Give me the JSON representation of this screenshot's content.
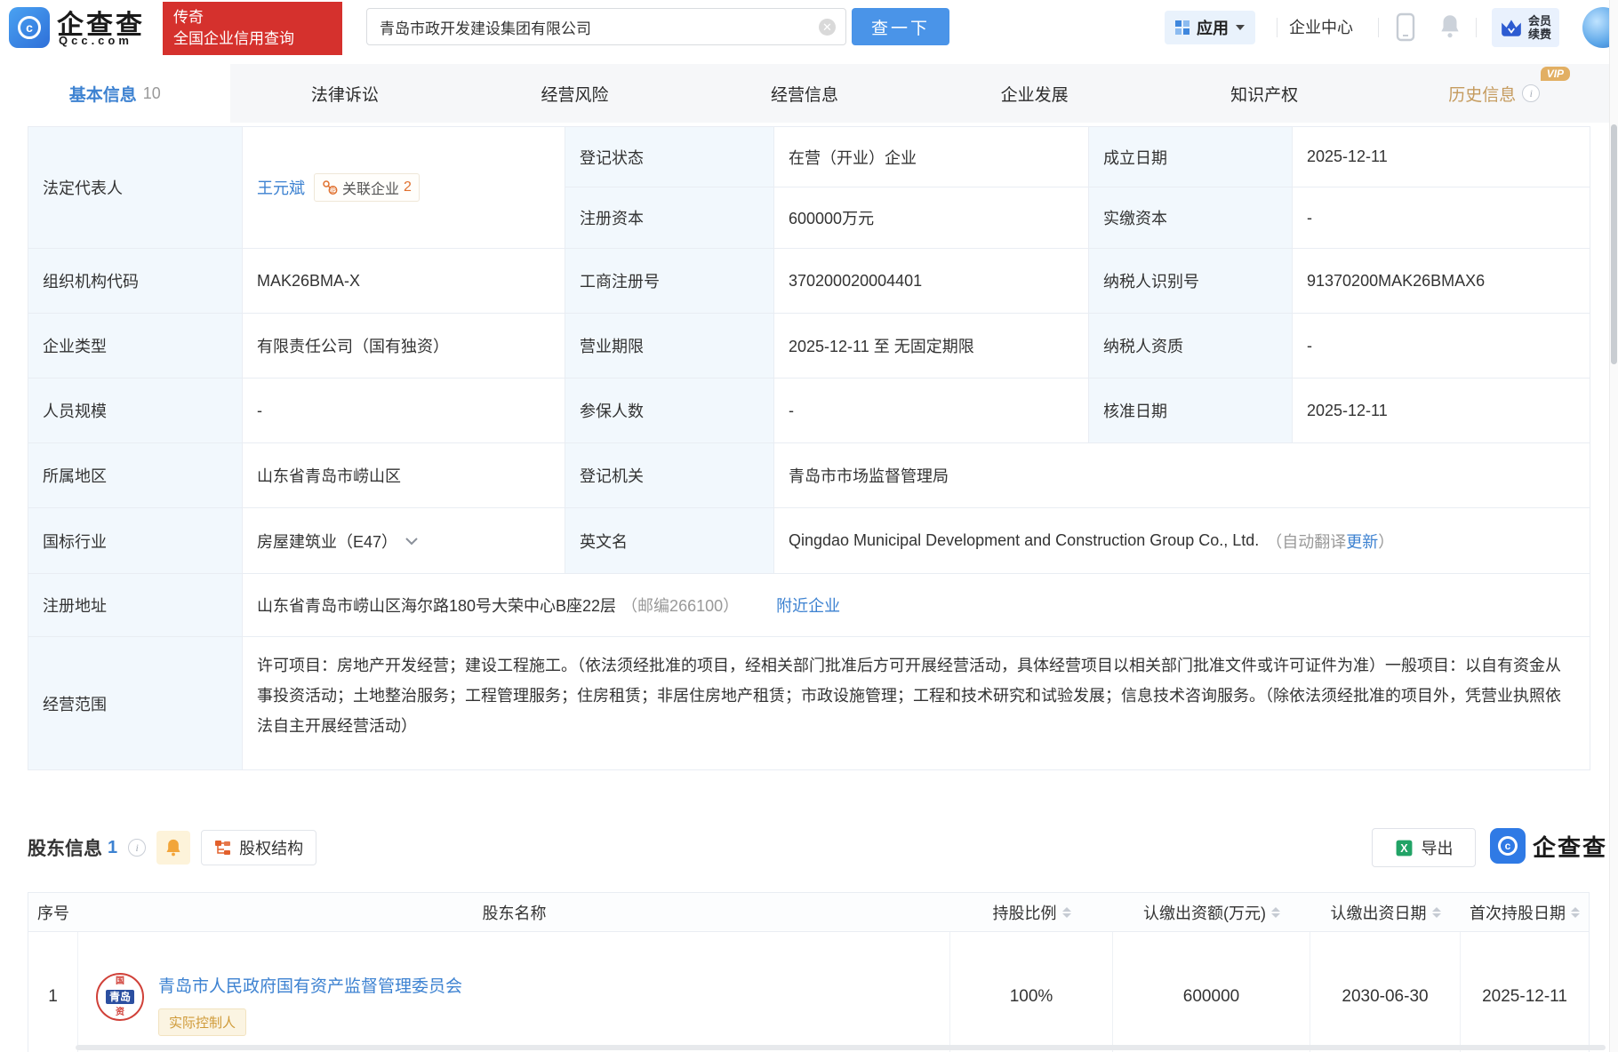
{
  "watermark": "企查查",
  "colors": {
    "brand_blue": "#3d82d1",
    "promo_red": "#d5312d",
    "history_gold": "#c59b5e",
    "accent_orange": "#e0702e",
    "excel_green": "#21a366"
  },
  "header": {
    "logo_title": "企查查",
    "logo_subtitle": "Qcc.com",
    "promo_line1": "传奇",
    "promo_line2": "全国企业信用查询",
    "search_value": "青岛市政开发建设集团有限公司",
    "search_button": "查一下",
    "apps_label": "应用",
    "enterprise_center": "企业中心",
    "vip_line1": "会员",
    "vip_line2": "续费"
  },
  "tabs": [
    {
      "label": "基本信息",
      "count": "10"
    },
    {
      "label": "法律诉讼"
    },
    {
      "label": "经营风险"
    },
    {
      "label": "经营信息"
    },
    {
      "label": "企业发展"
    },
    {
      "label": "知识产权"
    },
    {
      "label": "历史信息",
      "vip": "VIP"
    }
  ],
  "info": {
    "legal_rep_label": "法定代表人",
    "legal_rep": "王元斌",
    "related_label": "关联企业",
    "related_count": "2",
    "reg_status_label": "登记状态",
    "reg_status": "在营（开业）企业",
    "est_date_label": "成立日期",
    "est_date": "2025-12-11",
    "reg_capital_label": "注册资本",
    "reg_capital": "600000万元",
    "paid_capital_label": "实缴资本",
    "paid_capital": "-",
    "org_code_label": "组织机构代码",
    "org_code": "MAK26BMA-X",
    "biz_reg_no_label": "工商注册号",
    "biz_reg_no": "370200020004401",
    "tax_id_label": "纳税人识别号",
    "tax_id": "91370200MAK26BMAX6",
    "company_type_label": "企业类型",
    "company_type": "有限责任公司（国有独资）",
    "biz_term_label": "营业期限",
    "biz_term": "2025-12-11 至 无固定期限",
    "taxpayer_qual_label": "纳税人资质",
    "taxpayer_qual": "-",
    "staff_size_label": "人员规模",
    "staff_size": "-",
    "insured_label": "参保人数",
    "insured": "-",
    "approval_date_label": "核准日期",
    "approval_date": "2025-12-11",
    "region_label": "所属地区",
    "region": "山东省青岛市崂山区",
    "reg_authority_label": "登记机关",
    "reg_authority": "青岛市市场监督管理局",
    "industry_label": "国标行业",
    "industry": "房屋建筑业（E47）",
    "en_name_label": "英文名",
    "en_name": "Qingdao Municipal Development and Construction Group Co., Ltd.",
    "en_name_note_open": "（自动翻译",
    "en_name_update": "更新",
    "en_name_note_close": "）",
    "address_label": "注册地址",
    "address": "山东省青岛市崂山区海尔路180号大荣中心B座22层",
    "address_zip": "（邮编266100）",
    "nearby_link": "附近企业",
    "scope_label": "经营范围",
    "scope": "许可项目：房地产开发经营；建设工程施工。（依法须经批准的项目，经相关部门批准后方可开展经营活动，具体经营项目以相关部门批准文件或许可证件为准）一般项目：以自有资金从事投资活动；土地整治服务；工程管理服务；住房租赁；非居住房地产租赁；市政设施管理；工程和技术研究和试验发展；信息技术咨询服务。（除依法须经批准的项目外，凭营业执照依法自主开展经营活动）"
  },
  "shareholders": {
    "title": "股东信息",
    "count": "1",
    "equity_button": "股权结构",
    "export_button": "导出",
    "brand": "企查查",
    "headers": [
      "序号",
      "股东名称",
      "持股比例",
      "认缴出资额(万元)",
      "认缴出资日期",
      "首次持股日期"
    ],
    "row": {
      "index": "1",
      "name": "青岛市人民政府国有资产监督管理委员会",
      "tag": "实际控制人",
      "ratio": "100%",
      "amount": "600000",
      "sub_date": "2030-06-30",
      "first_date": "2025-12-11",
      "logo_top": "国",
      "logo_mid": "青岛",
      "logo_bottom": "资"
    }
  }
}
